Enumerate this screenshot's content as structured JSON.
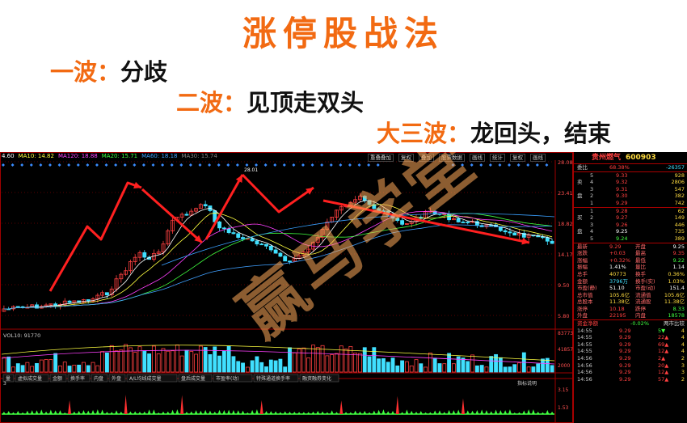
{
  "title": "涨停股战法",
  "waves": [
    {
      "label": "一波：",
      "text": "分歧"
    },
    {
      "label": "二波：",
      "text": "见顶走双头"
    },
    {
      "label": "大三波：",
      "text": "龙回头，结束"
    }
  ],
  "watermark": "赢马学堂",
  "chart_header": {
    "ma_legend": [
      {
        "text": "4.60",
        "color": "#ffffff"
      },
      {
        "text": "MA10: 14.82",
        "color": "#ffff40"
      },
      {
        "text": "MA120: 18.88",
        "color": "#ff40ff"
      },
      {
        "text": "MA20: 15.71",
        "color": "#40ff40"
      },
      {
        "text": "MA60: 18.18",
        "color": "#40a0ff"
      },
      {
        "text": "MA30: 15.74",
        "color": "#808080"
      }
    ],
    "toolbar": [
      "重叠叠加",
      "复权",
      "叠加",
      "股票数据",
      "画线",
      "统计",
      "复权",
      "画线"
    ]
  },
  "price_axis": [
    "28.08",
    "23.41",
    "18.82",
    "14.17",
    "9.50",
    "5.80"
  ],
  "peak_label": "28.01",
  "volume": {
    "legend": "VOL10: 91770",
    "axis": [
      "83773",
      "41857",
      "2000"
    ]
  },
  "indicator_tabs": [
    "量",
    "虚拟成交量",
    "金额",
    "换手率",
    "内盘",
    "外盘",
    "A/L均线成交量",
    "盘后成交量",
    "市盈率(动)",
    "特殊通道换手率",
    "融资融券变化"
  ],
  "bottom_legend": {
    "left": "3",
    "right": "指标说明",
    "axis": [
      "3.15",
      "1.53"
    ]
  },
  "quote": {
    "name": "贵州燃气",
    "code": "600903",
    "weibi": {
      "label": "委比",
      "value": "68.38%",
      "diff": "-26357"
    },
    "sell_side": "卖盘",
    "buy_side": "买盘",
    "sells": [
      {
        "level": "5",
        "price": "9.33",
        "volume": "928"
      },
      {
        "level": "4",
        "price": "9.32",
        "volume": "2806"
      },
      {
        "level": "3",
        "price": "9.31",
        "volume": "547"
      },
      {
        "level": "2",
        "price": "9.30",
        "volume": "382"
      },
      {
        "level": "1",
        "price": "9.29",
        "volume": "742"
      }
    ],
    "buys": [
      {
        "level": "1",
        "price": "9.28",
        "volume": "62"
      },
      {
        "level": "2",
        "price": "9.27",
        "volume": "149"
      },
      {
        "level": "3",
        "price": "9.26",
        "volume": "446"
      },
      {
        "level": "4",
        "price": "9.25",
        "volume": "735"
      },
      {
        "level": "5",
        "price": "9.24",
        "volume": "389"
      }
    ],
    "stats": [
      {
        "l1": "最新",
        "v1": "9.29",
        "l2": "开盘",
        "v2": "9.25",
        "c1": "#ff4040",
        "c2": "#ffffff"
      },
      {
        "l1": "涨跌",
        "v1": "+0.03",
        "l2": "最高",
        "v2": "9.35",
        "c1": "#ff4040",
        "c2": "#ff4040"
      },
      {
        "l1": "涨幅",
        "v1": "+0.32%",
        "l2": "最低",
        "v2": "9.22",
        "c1": "#ff4040",
        "c2": "#40ff40"
      },
      {
        "l1": "振幅",
        "v1": "1.41%",
        "l2": "量比",
        "v2": "1.14",
        "c1": "#ffffff",
        "c2": "#ffffff"
      },
      {
        "l1": "总手",
        "v1": "40773",
        "l2": "换手",
        "v2": "0.36%",
        "c1": "#ffdc40",
        "c2": "#ffdc40"
      },
      {
        "l1": "金额",
        "v1": "3796万",
        "l2": "换手(实)",
        "v2": "1.03%",
        "c1": "#40e0ff",
        "c2": "#ffdc40"
      },
      {
        "l1": "市盈(静)",
        "v1": "51.10",
        "l2": "市盈(动)",
        "v2": "151.4",
        "c1": "#ffffff",
        "c2": "#ffffff"
      },
      {
        "l1": "总市值",
        "v1": "105.6亿",
        "l2": "流通值",
        "v2": "105.6亿",
        "c1": "#ffdc40",
        "c2": "#ffdc40"
      },
      {
        "l1": "总股本",
        "v1": "11.38亿",
        "l2": "流通股",
        "v2": "11.38亿",
        "c1": "#ffdc40",
        "c2": "#ffdc40"
      },
      {
        "l1": "涨停",
        "v1": "10.18",
        "l2": "跌停",
        "v2": "8.33",
        "c1": "#ff4040",
        "c2": "#40ff40"
      },
      {
        "l1": "外盘",
        "v1": "22195",
        "l2": "内盘",
        "v2": "18578",
        "c1": "#ff4040",
        "c2": "#40ff40"
      }
    ],
    "flow": {
      "label": "资金净额",
      "value": "-0.02%",
      "right": "两市比较"
    },
    "ticks": [
      {
        "time": "14:55",
        "price": "9.29",
        "vol": "5",
        "dir": "down",
        "n": "4"
      },
      {
        "time": "14:55",
        "price": "9.29",
        "vol": "22",
        "dir": "up",
        "n": "4"
      },
      {
        "time": "14:55",
        "price": "9.29",
        "vol": "69",
        "dir": "up",
        "n": "4"
      },
      {
        "time": "14:55",
        "price": "9.29",
        "vol": "12",
        "dir": "up",
        "n": "4"
      },
      {
        "time": "14:56",
        "price": "9.29",
        "vol": "2",
        "dir": "up",
        "n": "2"
      },
      {
        "time": "14:56",
        "price": "9.29",
        "vol": "20",
        "dir": "up",
        "n": "3"
      },
      {
        "time": "14:56",
        "price": "9.29",
        "vol": "12",
        "dir": "up",
        "n": "3"
      },
      {
        "time": "14:56",
        "price": "9.29",
        "vol": "57",
        "dir": "up",
        "n": "2"
      }
    ]
  },
  "colors": {
    "accent": "#f26a12",
    "up": "#ff4040",
    "down": "#40e0ff",
    "arrow": "#ff2020"
  }
}
